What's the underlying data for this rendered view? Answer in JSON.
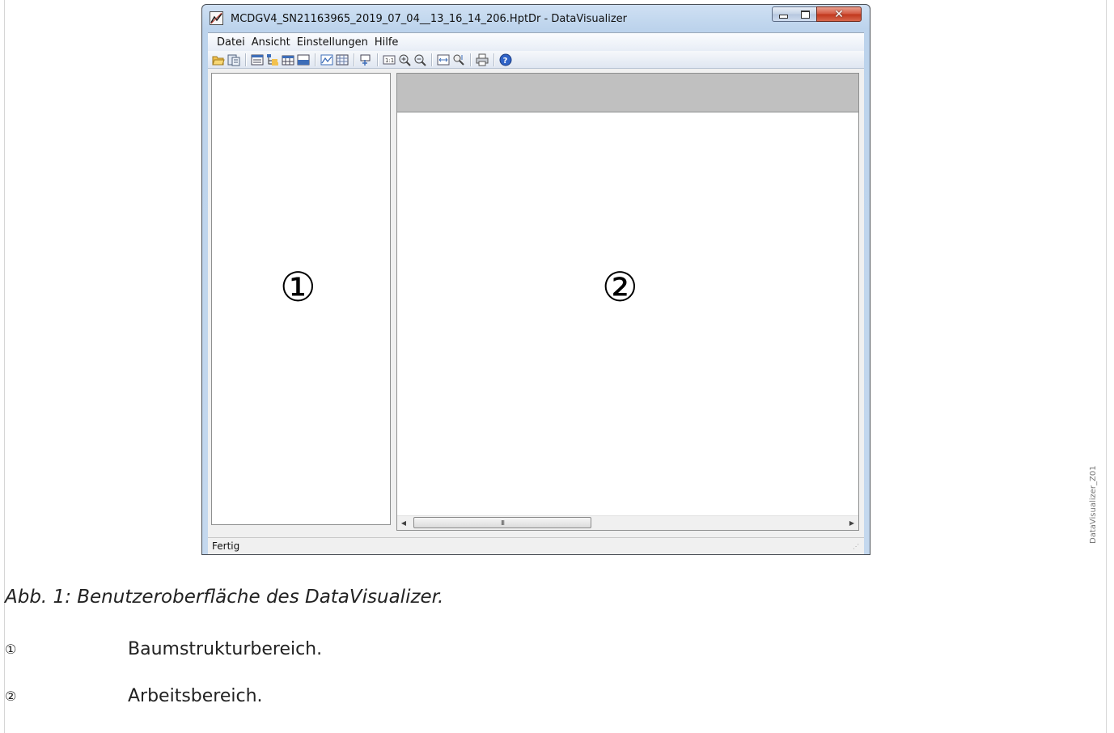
{
  "window": {
    "title": "MCDGV4_SN21163965_2019_07_04__13_16_14_206.HptDr - DataVisualizer",
    "controls": {
      "minimize": "minimize-icon",
      "maximize": "maximize-icon",
      "close": "close-icon"
    }
  },
  "menu": {
    "items": [
      "Datei",
      "Ansicht",
      "Einstellungen",
      "Hilfe"
    ]
  },
  "toolbar": {
    "icons": [
      "open-folder-icon",
      "save-icon",
      "list-view-icon",
      "tree-view-icon",
      "table-icon",
      "panel-icon",
      "chart-icon",
      "grid-icon",
      "cursor-icon",
      "zoom-1to1-icon",
      "zoom-in-icon",
      "zoom-out-icon",
      "fit-width-icon",
      "fit-height-icon",
      "print-icon",
      "help-icon"
    ]
  },
  "panes": {
    "tree_marker": "①",
    "work_marker": "②"
  },
  "scrollbar": {
    "grip": "III"
  },
  "status": {
    "text": "Fertig"
  },
  "figure": {
    "caption": "Abb. 1: Benutzeroberfläche des DataVisualizer.",
    "legend": [
      {
        "num": "①",
        "text": "Baumstrukturbereich."
      },
      {
        "num": "②",
        "text": "Arbeitsbereich."
      }
    ],
    "side_id": "DataVisualizer_Z01"
  },
  "colors": {
    "title_bg": "#bcd3ec",
    "close_button": "#c0361c",
    "work_header": "#c0c0c0"
  }
}
